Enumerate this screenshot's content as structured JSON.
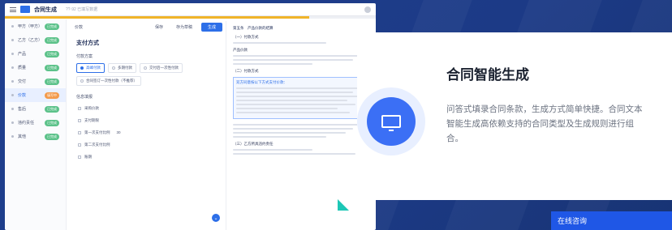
{
  "app": {
    "title": "合同生成",
    "subtitle": "??·92 已填写数据",
    "progress_fraction": 0.82,
    "progress_color": "#f0b429"
  },
  "sidebar": {
    "items": [
      {
        "label": "甲方（甲方）",
        "badge": "已完成",
        "active": false
      },
      {
        "label": "乙方（乙方）",
        "badge": "已完成",
        "active": false
      },
      {
        "label": "产品",
        "badge": "已完成",
        "active": false
      },
      {
        "label": "质量",
        "badge": "已完成",
        "active": false
      },
      {
        "label": "交付",
        "badge": "已完成",
        "active": false
      },
      {
        "label": "价款",
        "badge": "填写中",
        "active": true
      },
      {
        "label": "售后",
        "badge": "已完成",
        "active": false
      },
      {
        "label": "违约责任",
        "badge": "已完成",
        "active": false
      },
      {
        "label": "其他",
        "badge": "已完成",
        "active": false
      }
    ]
  },
  "form": {
    "header_label": "价款",
    "btn_cancel": "保存",
    "btn_draft": "存为草稿",
    "btn_generate": "生成",
    "section_title": "支付方式",
    "method_label": "付款方案",
    "methods": [
      "高峰付款",
      "多期付款",
      "交付后一次性付款",
      "合同签订一次性付款（不推荐）"
    ],
    "info_title": "信息填报",
    "fields": [
      {
        "label": "采购价款",
        "value": ""
      },
      {
        "label": "支付期限",
        "value": ""
      },
      {
        "label": "第一次支付比例",
        "value": "30"
      },
      {
        "label": "第二次支付比例",
        "value": ""
      },
      {
        "label": "账期",
        "value": ""
      }
    ]
  },
  "doc": {
    "section": "第五条　产品价款的结算",
    "items": [
      "（一）付款方式",
      "产品价款",
      "（二）付款方式",
      "（三）乙方所具违约责任"
    ],
    "highlight_title": "双方同意按以下方式支付价款："
  },
  "card": {
    "title": "合同智能生成",
    "description": "问答式填录合同条款，生成方式简单快捷。合同文本智能生成高依赖支持的合同类型及生成规则进行组合。",
    "icon": "monitor-icon",
    "accent": "#3b6ff5"
  },
  "consult": {
    "label": "在线咨询"
  }
}
